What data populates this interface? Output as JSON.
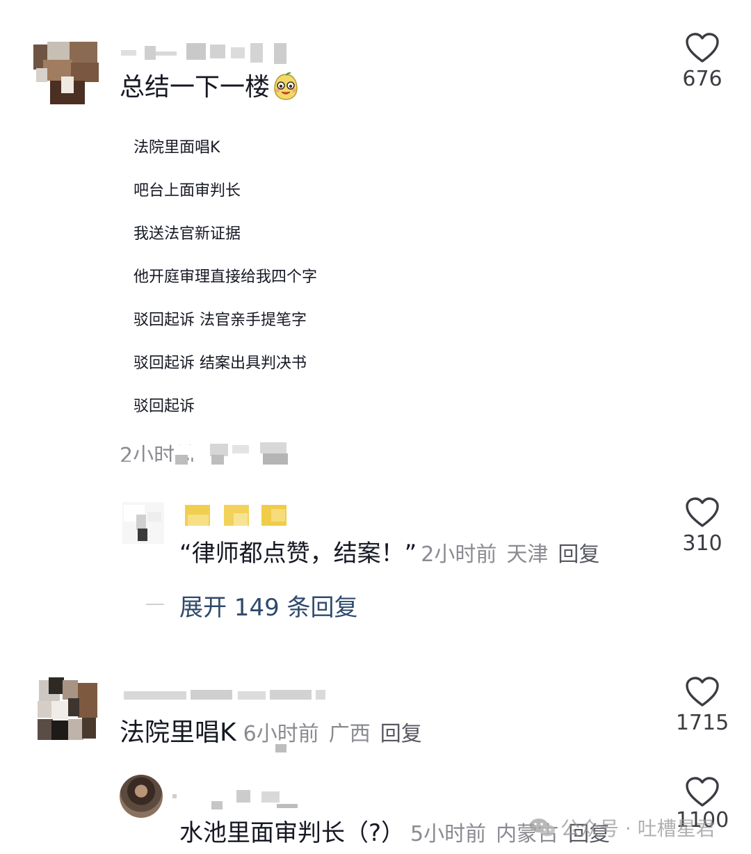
{
  "comments": [
    {
      "text": "总结一下一楼",
      "emoji": "smiling-pear-emoji",
      "lyrics": [
        "法院里面唱K",
        "吧台上面审判长",
        "我送法官新证据",
        "他开庭审理直接给我四个字",
        "驳回起诉 法官亲手提笔字",
        "驳回起诉 结案出具判决书",
        "驳回起诉"
      ],
      "time": "2小时前",
      "likes": "676",
      "reply": {
        "text": "“律师都点赞，结案！”",
        "time": "2小时前",
        "location": "天津",
        "reply_label": "回复",
        "likes": "310"
      },
      "expand_label": "展开 149 条回复"
    },
    {
      "text": "法院里唱K",
      "time": "6小时前",
      "location": "广西",
      "reply_label": "回复",
      "likes": "1715",
      "reply": {
        "text": "水池里面审判长（?）",
        "time": "5小时前",
        "location": "内蒙古",
        "reply_label": "回复",
        "likes": "1100"
      }
    }
  ],
  "watermark": {
    "text": "公众号 · 吐槽星君",
    "icon": "wechat-icon"
  },
  "colors": {
    "text": "#161823",
    "meta": "#8a8b91",
    "expand": "#2e4a6b",
    "like_outline": "#3b3c42"
  }
}
